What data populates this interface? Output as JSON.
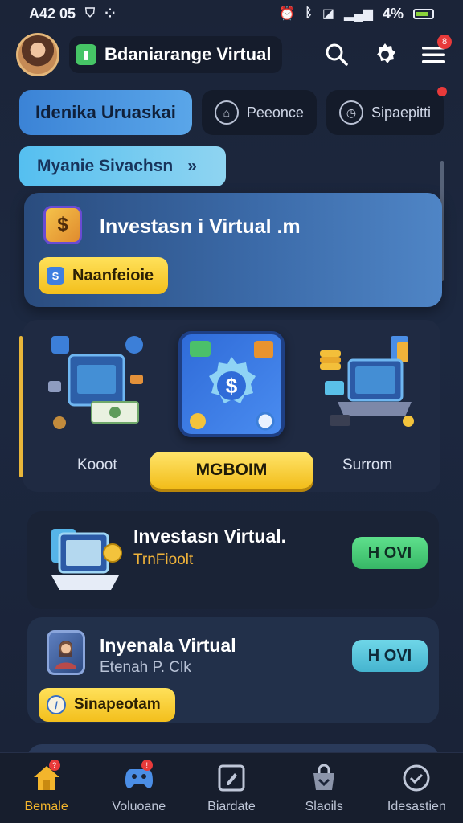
{
  "status_bar": {
    "time": "A42 05",
    "battery": "4%"
  },
  "header": {
    "app_title": "Bdaniarange Virtual",
    "notification_count": "8"
  },
  "chips": [
    {
      "label": "Idenika Uruaskai",
      "active": true
    },
    {
      "label": "Peeonce",
      "active": false
    },
    {
      "label": "Sipaepitti",
      "active": false
    }
  ],
  "section": {
    "label": "Myanie Sivachsn",
    "chevron": "»"
  },
  "hero": {
    "title": "Investasn i Virtual .m",
    "tag": "Naanfeioie"
  },
  "carousel": {
    "left_label": "Kooot",
    "cta_label": "MGBOIM",
    "right_label": "Surrom"
  },
  "list": [
    {
      "title": "Investasn Virtual.",
      "subtitle": "TrnFioolt",
      "button": "H OVI"
    },
    {
      "title": "Inyenala Virtual",
      "subtitle": "Etenah P. Clk",
      "button": "H OVI",
      "tag": "Sinapeotam"
    }
  ],
  "bottom_nav": [
    {
      "label": "Bemale",
      "active": true,
      "badge": "?"
    },
    {
      "label": "Voluoane",
      "active": false,
      "badge": "!"
    },
    {
      "label": "Biardate",
      "active": false
    },
    {
      "label": "Slaoils",
      "active": false
    },
    {
      "label": "Idesastien",
      "active": false
    }
  ]
}
